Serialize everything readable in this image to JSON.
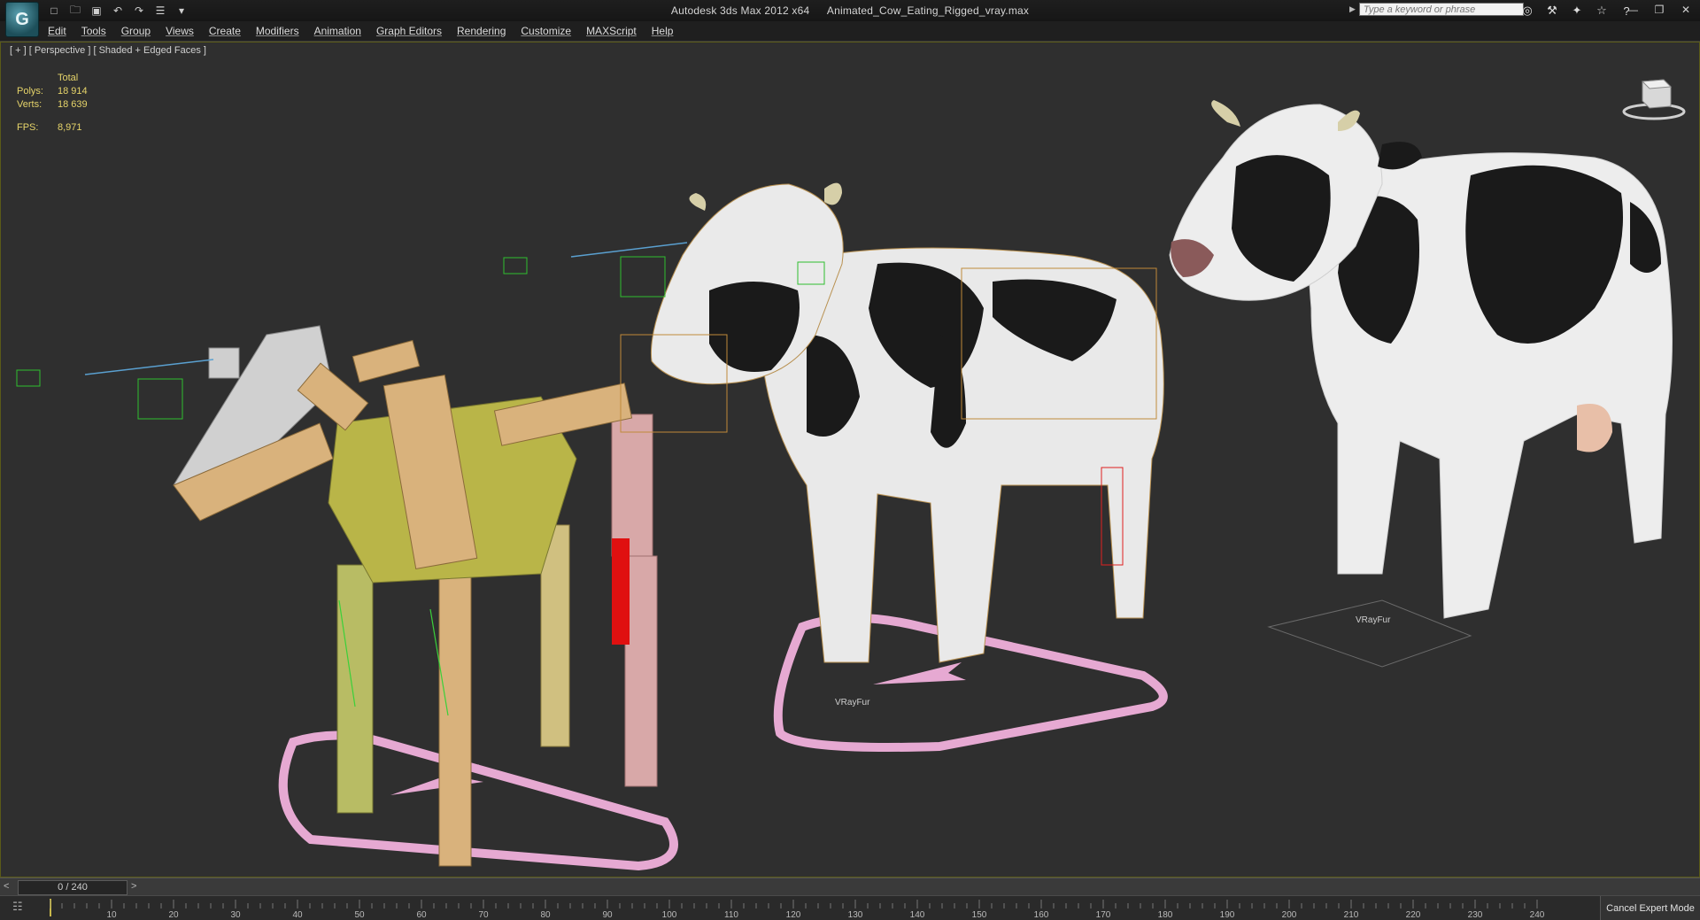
{
  "title_bar": {
    "app_title": "Autodesk 3ds Max  2012 x64",
    "file_name": "Animated_Cow_Eating_Rigged_vray.max",
    "logo_text": "G",
    "search_placeholder": "Type a keyword or phrase"
  },
  "menu": [
    "Edit",
    "Tools",
    "Group",
    "Views",
    "Create",
    "Modifiers",
    "Animation",
    "Graph Editors",
    "Rendering",
    "Customize",
    "MAXScript",
    "Help"
  ],
  "viewport": {
    "label": "[ + ] [ Perspective ] [ Shaded + Edged Faces ]",
    "stats": {
      "header": "Total",
      "polys_label": "Polys:",
      "polys": "18 914",
      "verts_label": "Verts:",
      "verts": "18 639",
      "fps_label": "FPS:",
      "fps": "8,971"
    },
    "fur_labels": [
      "VRayFur",
      "VRayFur"
    ]
  },
  "timeline": {
    "frame_display": "0 / 240",
    "prev": "<",
    "next": ">",
    "ticks": [
      "10",
      "20",
      "30",
      "40",
      "50",
      "60",
      "70",
      "80",
      "90",
      "100",
      "110",
      "120",
      "130",
      "140",
      "150",
      "160",
      "170",
      "180",
      "190",
      "200",
      "210",
      "220",
      "230",
      "240"
    ],
    "cancel_expert": "Cancel Expert Mode"
  },
  "colors": {
    "viewport_bg": "#2f2f2f",
    "stats_text": "#e6d46a",
    "bone_tan": "#d9b27c",
    "bone_olive": "#c2c46a",
    "bone_pink": "#d8a8a8",
    "path_pink": "#e6a9d2",
    "helper_green": "#2fbf2f",
    "wire_orange": "#c08a3a"
  },
  "icons": [
    "new-file-icon",
    "open-file-icon",
    "save-icon",
    "undo-icon",
    "redo-icon",
    "project-icon",
    "binoculars-icon",
    "tools-icon",
    "satellite-icon",
    "star-icon",
    "help-icon",
    "minimize-icon",
    "restore-icon",
    "close-icon",
    "viewcube-icon",
    "timeline-config-icon"
  ]
}
